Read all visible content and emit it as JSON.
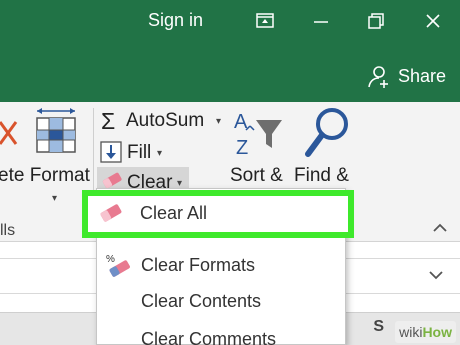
{
  "window": {
    "title": "Sign in",
    "share_label": "Share"
  },
  "ribbon": {
    "format_label": "ete Format",
    "autosum_label": "AutoSum",
    "fill_label": "Fill",
    "clear_label": "Clear",
    "sort_label": "Sort &",
    "find_label": "Find &",
    "group_label": "lls"
  },
  "clear_menu": {
    "items": [
      {
        "label": "Clear All",
        "icon": "eraser-icon"
      },
      {
        "label": "Clear Formats",
        "icon": "clear-formats-icon"
      },
      {
        "label": "Clear Contents",
        "icon": ""
      },
      {
        "label": "Clear Comments",
        "icon": ""
      }
    ]
  },
  "sheet": {
    "column_letter": "S"
  },
  "watermark": {
    "part1": "wiki",
    "part2": "How"
  },
  "colors": {
    "excel_green": "#217346",
    "highlight_green": "#3ee92b",
    "ribbon_bg": "#f3f3f3",
    "eraser_pink": "#e87a90",
    "icon_blue": "#2b579a"
  }
}
